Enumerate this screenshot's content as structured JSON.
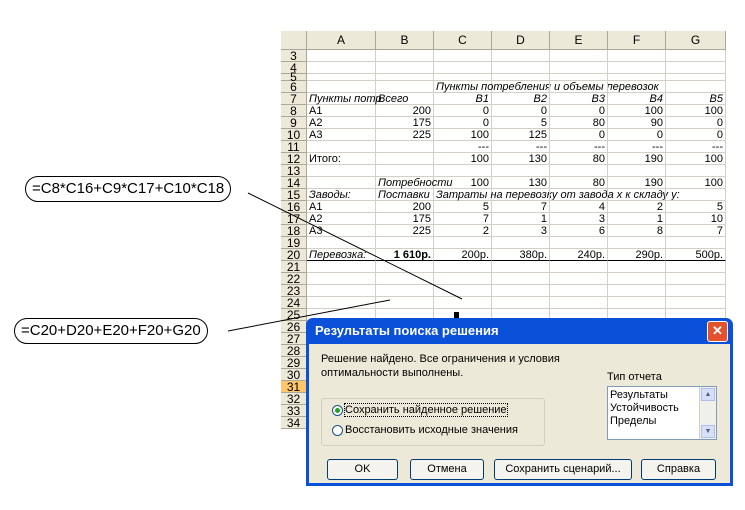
{
  "sheet": {
    "columns": [
      "A",
      "B",
      "C",
      "D",
      "E",
      "F",
      "G"
    ],
    "rows": [
      {
        "n": "3",
        "cells": [
          "",
          "",
          "",
          "",
          "",
          "",
          ""
        ]
      },
      {
        "n": "4",
        "cells": [
          "",
          "",
          "",
          "",
          "",
          "",
          ""
        ]
      },
      {
        "n": "5",
        "cells": [
          "",
          "",
          "",
          "",
          "",
          "",
          ""
        ]
      },
      {
        "n": "6",
        "cells": [
          "",
          "",
          "Пункты потребления и объемы перевозок",
          "",
          "",
          "",
          ""
        ]
      },
      {
        "n": "7",
        "cells": [
          "Пункты потр",
          "Всего",
          "B1",
          "B2",
          "B3",
          "B4",
          "B5"
        ]
      },
      {
        "n": "8",
        "cells": [
          "A1",
          "200",
          "0",
          "0",
          "0",
          "100",
          "100"
        ]
      },
      {
        "n": "9",
        "cells": [
          "A2",
          "175",
          "0",
          "5",
          "80",
          "90",
          "0"
        ]
      },
      {
        "n": "10",
        "cells": [
          "A3",
          "225",
          "100",
          "125",
          "0",
          "0",
          "0"
        ]
      },
      {
        "n": "11",
        "cells": [
          "",
          "",
          "---",
          "---",
          "---",
          "---",
          "---"
        ]
      },
      {
        "n": "12",
        "cells": [
          "Итого:",
          "",
          "100",
          "130",
          "80",
          "190",
          "100"
        ]
      },
      {
        "n": "13",
        "cells": [
          "",
          "",
          "",
          "",
          "",
          "",
          ""
        ]
      },
      {
        "n": "14",
        "cells": [
          "",
          "Потребности",
          "100",
          "130",
          "80",
          "190",
          "100"
        ]
      },
      {
        "n": "15",
        "cells": [
          "Заводы:",
          "Поставки",
          "Затраты на перевозку от завода x к складу y:",
          "",
          "",
          "",
          ""
        ]
      },
      {
        "n": "16",
        "cells": [
          "A1",
          "200",
          "5",
          "7",
          "4",
          "2",
          "5"
        ]
      },
      {
        "n": "17",
        "cells": [
          "A2",
          "175",
          "7",
          "1",
          "3",
          "1",
          "10"
        ]
      },
      {
        "n": "18",
        "cells": [
          "A3",
          "225",
          "2",
          "3",
          "6",
          "8",
          "7"
        ]
      },
      {
        "n": "19",
        "cells": [
          "",
          "",
          "",
          "",
          "",
          "",
          ""
        ]
      },
      {
        "n": "20",
        "cells": [
          "Перевозка:",
          "1 610р.",
          "200р.",
          "380р.",
          "240р.",
          "290р.",
          "500р."
        ]
      },
      {
        "n": "21",
        "cells": [
          "",
          "",
          "",
          "",
          "",
          "",
          ""
        ]
      },
      {
        "n": "22",
        "cells": [
          "",
          "",
          "",
          "",
          "",
          "",
          ""
        ]
      },
      {
        "n": "23",
        "cells": [
          "",
          "",
          "",
          "",
          "",
          "",
          ""
        ]
      },
      {
        "n": "24",
        "cells": [
          "",
          "",
          "",
          "",
          "",
          "",
          ""
        ]
      },
      {
        "n": "25",
        "cells": [
          "",
          "",
          "",
          "",
          "",
          "",
          ""
        ]
      },
      {
        "n": "26",
        "cells": [
          "",
          "",
          "",
          "",
          "",
          "",
          ""
        ]
      },
      {
        "n": "27",
        "cells": [
          "",
          "",
          "",
          "",
          "",
          "",
          ""
        ]
      },
      {
        "n": "28",
        "cells": [
          "",
          "",
          "",
          "",
          "",
          "",
          ""
        ]
      },
      {
        "n": "29",
        "cells": [
          "",
          "",
          "",
          "",
          "",
          "",
          ""
        ]
      },
      {
        "n": "30",
        "cells": [
          "",
          "",
          "",
          "",
          "",
          "",
          ""
        ]
      },
      {
        "n": "31",
        "cells": [
          "",
          "",
          "",
          "",
          "",
          "",
          ""
        ]
      },
      {
        "n": "32",
        "cells": [
          "",
          "",
          "",
          "",
          "",
          "",
          ""
        ]
      },
      {
        "n": "33",
        "cells": [
          "",
          "",
          "",
          "",
          "",
          "",
          ""
        ]
      },
      {
        "n": "34",
        "cells": [
          "",
          "",
          "",
          "",
          "",
          "",
          ""
        ]
      }
    ],
    "selected_row": "31"
  },
  "callouts": {
    "formula1": "=C8*C16+C9*C17+C10*C18",
    "formula2": "=C20+D20+E20+F20+G20"
  },
  "dialog": {
    "title": "Результаты поиска решения",
    "close_glyph": "✕",
    "message": "Решение найдено. Все ограничения и условия оптимальности выполнены.",
    "report_type_label": "Тип отчета",
    "report_types": [
      "Результаты",
      "Устойчивость",
      "Пределы"
    ],
    "radio_keep": "Сохранить найденное решение",
    "radio_restore": "Восстановить исходные значения",
    "selected_option": "keep",
    "buttons": {
      "ok": "OK",
      "cancel": "Отмена",
      "save_scenario": "Сохранить сценарий...",
      "help": "Справка"
    }
  }
}
